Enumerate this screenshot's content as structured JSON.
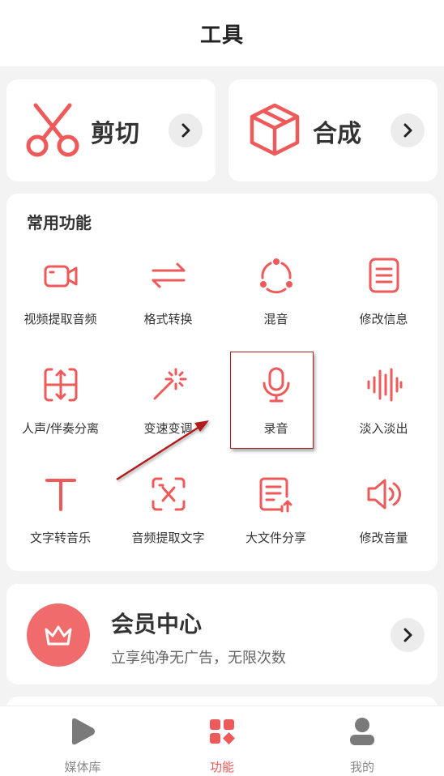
{
  "header": {
    "title": "工具"
  },
  "top_cards": [
    {
      "label": "剪切",
      "icon": "scissors-icon"
    },
    {
      "label": "合成",
      "icon": "cube-icon"
    }
  ],
  "functions": {
    "title": "常用功能",
    "items": [
      {
        "label": "视频提取音频",
        "icon": "video-camera-icon"
      },
      {
        "label": "格式转换",
        "icon": "swap-arrows-icon"
      },
      {
        "label": "混音",
        "icon": "mix-cycle-icon"
      },
      {
        "label": "修改信息",
        "icon": "document-lines-icon"
      },
      {
        "label": "人声/伴奏分离",
        "icon": "split-vertical-icon"
      },
      {
        "label": "变速变调",
        "icon": "magic-wand-icon"
      },
      {
        "label": "录音",
        "icon": "microphone-icon"
      },
      {
        "label": "淡入淡出",
        "icon": "sound-wave-icon"
      },
      {
        "label": "文字转音乐",
        "icon": "text-t-icon"
      },
      {
        "label": "音频提取文字",
        "icon": "text-scan-icon"
      },
      {
        "label": "大文件分享",
        "icon": "file-upload-icon"
      },
      {
        "label": "修改音量",
        "icon": "speaker-volume-icon"
      }
    ]
  },
  "vip": {
    "title": "会员中心",
    "subtitle": "立享纯净无广告，无限次数",
    "icon": "crown-icon"
  },
  "tabbar": {
    "items": [
      {
        "label": "媒体库",
        "icon": "play-triangle-icon",
        "active": false
      },
      {
        "label": "功能",
        "icon": "grid-shapes-icon",
        "active": true
      },
      {
        "label": "我的",
        "icon": "user-icon",
        "active": false
      }
    ]
  },
  "colors": {
    "accent": "#ee5a5a",
    "accent_soft": "#f06c6c",
    "annotation": "#b01e1e",
    "inactive": "#888888"
  }
}
